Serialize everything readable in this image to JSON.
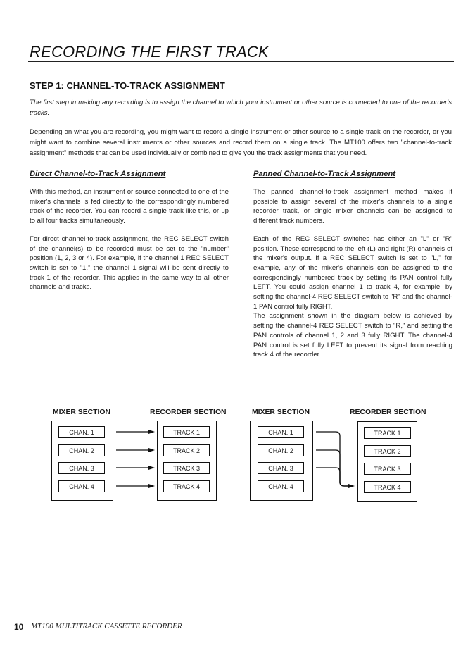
{
  "header": {
    "title": "RECORDING THE FIRST TRACK",
    "step_heading": "STEP 1: CHANNEL-TO-TRACK ASSIGNMENT"
  },
  "intro": {
    "italic": "The first step in making any recording is to assign the channel to which your instrument or other source is connected to one of the recorder's tracks.",
    "body": "Depending on what you are recording, you might want to record a single instrument or other source to a single track on the recorder, or you might want to combine several instruments or other sources and record them on a single track. The MT100 offers two \"channel-to-track assignment\" methods that can be used individually or combined to give you the track assignments that you need."
  },
  "direct": {
    "heading": "Direct Channel-to-Track Assignment",
    "paragraphs": [
      "With this method, an instrument or source connected to one of the mixer's channels is fed directly to the correspondingly numbered track of the recorder. You can record a single track like this, or up to all four tracks simultaneously.",
      "For direct channel-to-track assignment, the REC SELECT switch of the channel(s) to be recorded must be set to the \"number\" position (1, 2, 3 or 4). For example, if the channel 1 REC SELECT switch is set to \"1,\" the channel 1 signal will be sent directly to track 1 of the recorder. This applies in the same way to all other channels and tracks."
    ]
  },
  "panned": {
    "heading": "Panned Channel-to-Track Assignment",
    "paragraphs": [
      "The panned channel-to-track assignment method makes it possible to assign several of the mixer's channels to a single recorder track, or single mixer channels can be assigned to different track numbers.",
      "Each of the REC SELECT switches has either an \"L\" or \"R\" position. These correspond to the left (L) and right (R) channels of the mixer's output. If a REC SELECT switch is set to \"L,\" for example, any of the mixer's channels can be assigned to the correspondingly numbered track by setting its PAN control fully LEFT. You could assign channel 1 to track 4, for example, by setting the channel-4 REC SELECT switch to \"R\" and the channel-1 PAN control fully RIGHT.",
      "The assignment shown in the diagram below is achieved by setting the channel-4 REC SELECT switch to \"R,\" and setting the PAN controls of channel 1, 2 and 3 fully RIGHT. The channel-4 PAN control is set fully LEFT to prevent its signal from reaching track 4 of the recorder."
    ]
  },
  "diagrams": {
    "direct": {
      "mixer_label": "MIXER SECTION",
      "recorder_label": "RECORDER SECTION",
      "channels": [
        "CHAN. 1",
        "CHAN. 2",
        "CHAN. 3",
        "CHAN. 4"
      ],
      "tracks": [
        "TRACK 1",
        "TRACK 2",
        "TRACK 3",
        "TRACK 4"
      ],
      "routing": [
        [
          1,
          1
        ],
        [
          2,
          2
        ],
        [
          3,
          3
        ],
        [
          4,
          4
        ]
      ]
    },
    "panned": {
      "mixer_label": "MIXER SECTION",
      "recorder_label": "RECORDER SECTION",
      "channels": [
        "CHAN. 1",
        "CHAN. 2",
        "CHAN. 3",
        "CHAN. 4"
      ],
      "tracks": [
        "TRACK 1",
        "TRACK 2",
        "TRACK 3",
        "TRACK 4"
      ],
      "routing": [
        [
          1,
          4
        ],
        [
          2,
          4
        ],
        [
          3,
          4
        ]
      ]
    }
  },
  "footer": {
    "page_number": "10",
    "book_title": "MT100 MULTITRACK CASSETTE RECORDER"
  }
}
